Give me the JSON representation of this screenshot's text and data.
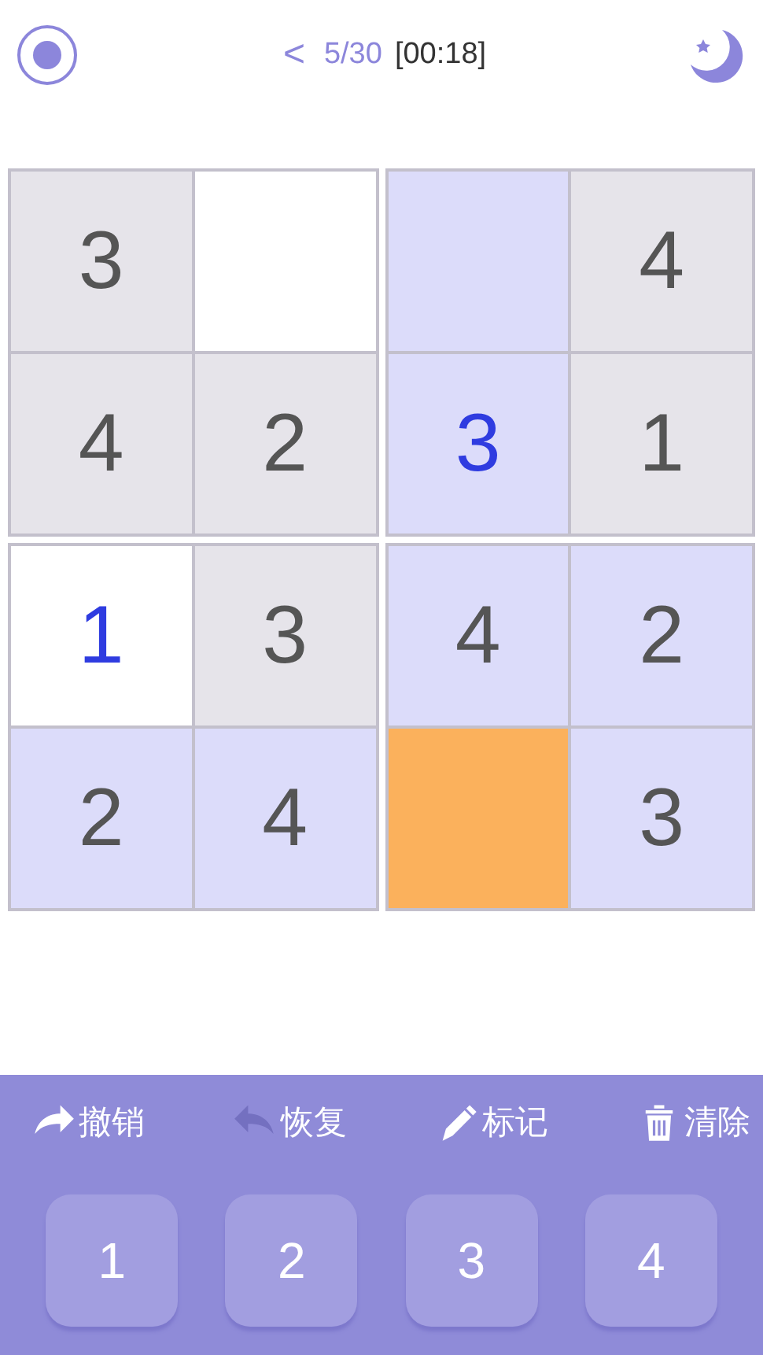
{
  "header": {
    "back": "<",
    "progress": "5/30",
    "timer": "[00:18]"
  },
  "boxes": [
    {
      "cells": [
        {
          "value": "3",
          "given": true,
          "related": false,
          "selected": false
        },
        {
          "given": false,
          "related": false,
          "selected": false
        },
        {
          "value": "4",
          "given": true,
          "related": false,
          "selected": false
        },
        {
          "value": "2",
          "given": true,
          "related": false,
          "selected": false
        }
      ]
    },
    {
      "cells": [
        {
          "given": false,
          "related": true,
          "selected": false
        },
        {
          "value": "4",
          "given": true,
          "related": false,
          "selected": false
        },
        {
          "value": "3",
          "given": false,
          "related": true,
          "selected": false
        },
        {
          "value": "1",
          "given": true,
          "related": false,
          "selected": false
        }
      ]
    },
    {
      "cells": [
        {
          "value": "1",
          "given": false,
          "related": false,
          "selected": false
        },
        {
          "value": "3",
          "given": true,
          "related": false,
          "selected": false
        },
        {
          "value": "2",
          "given": true,
          "related": true,
          "selected": false
        },
        {
          "value": "4",
          "given": true,
          "related": true,
          "selected": false
        }
      ]
    },
    {
      "cells": [
        {
          "value": "4",
          "given": true,
          "related": true,
          "selected": false
        },
        {
          "value": "2",
          "given": true,
          "related": true,
          "selected": false
        },
        {
          "given": false,
          "selected": true
        },
        {
          "value": "3",
          "given": true,
          "related": true,
          "selected": false
        }
      ]
    }
  ],
  "tools": [
    {
      "kind": "undo",
      "label": "撤销",
      "disabled": false
    },
    {
      "kind": "redo",
      "label": "恢复",
      "disabled": true
    },
    {
      "kind": "mark",
      "label": "标记",
      "disabled": false
    },
    {
      "kind": "clear",
      "label": "清除",
      "disabled": false
    }
  ],
  "keys": [
    "1",
    "2",
    "3",
    "4"
  ]
}
